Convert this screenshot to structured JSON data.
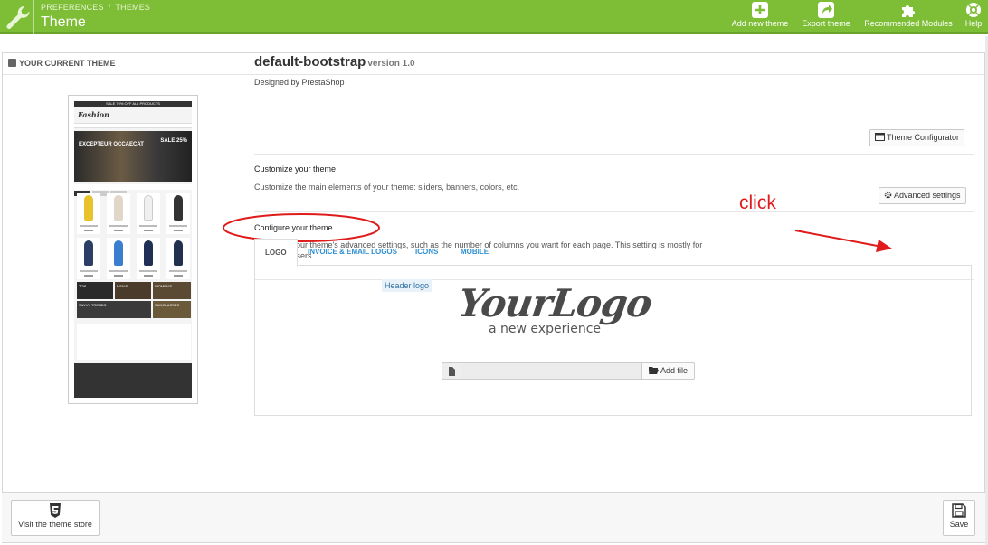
{
  "header": {
    "breadcrumb": [
      "PREFERENCES",
      "THEMES"
    ],
    "title": "Theme",
    "toolbar": [
      {
        "label": "Add new theme",
        "icon": "plus-icon"
      },
      {
        "label": "Export theme",
        "icon": "share-icon"
      },
      {
        "label": "Recommended Modules",
        "icon": "puzzle-icon"
      },
      {
        "label": "Help",
        "icon": "lifebuoy-icon"
      }
    ]
  },
  "panel": {
    "heading": "YOUR CURRENT THEME"
  },
  "preview": {
    "top_banner": "SALE 70% OFF ALL PRODUCTS",
    "logo_text": "Fashion",
    "banner_text": "EXCEPTEUR OCCAECAT",
    "sale_text": "SALE 25%"
  },
  "theme": {
    "name": "default-bootstrap",
    "version": "version 1.0",
    "designed_by": "Designed by PrestaShop"
  },
  "customize": {
    "title": "Customize your theme",
    "description": "Customize the main elements of your theme: sliders, banners, colors, etc.",
    "button": "Theme Configurator"
  },
  "configure": {
    "title": "Configure your theme",
    "description_line1": "Configure your theme's advanced settings, such as the number of columns you want for each page. This setting is mostly for",
    "description_line2": "advanced users.",
    "button": "Advanced settings"
  },
  "annotation": {
    "click_label": "click",
    "color": "#e01b1b"
  },
  "logo_tabs": {
    "tabs": [
      "LOGO",
      "INVOICE & EMAIL LOGOS",
      "ICONS",
      "MOBILE"
    ],
    "active": "LOGO",
    "header_logo_label": "Header logo",
    "logo_image_text": "YourLogo",
    "logo_image_tagline": "a new experience",
    "add_file_button": "Add file"
  },
  "footer": {
    "store_button": "Visit the theme store",
    "save_button": "Save"
  },
  "colors": {
    "header_green": "#7ebd36",
    "link_blue": "#2e8fd1"
  }
}
